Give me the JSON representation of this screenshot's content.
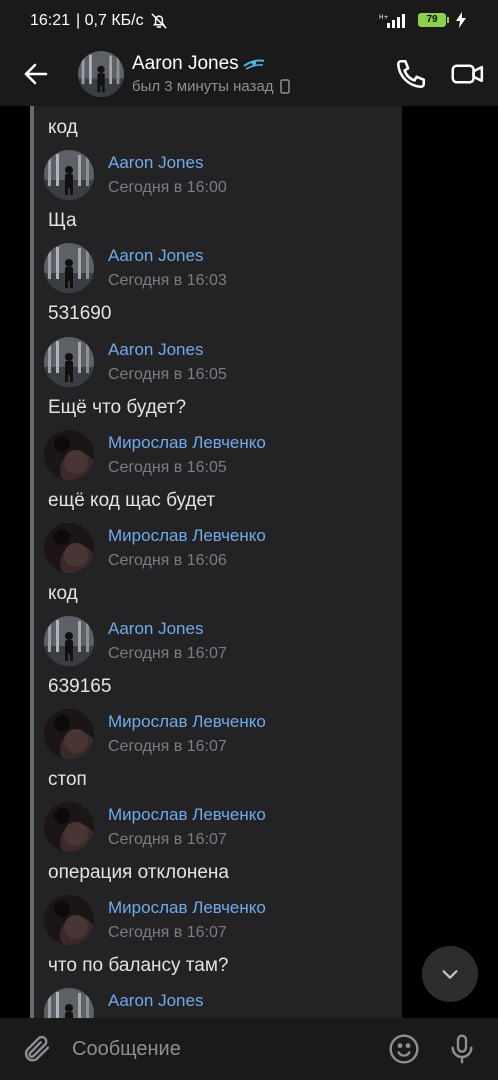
{
  "status_bar": {
    "time": "16:21",
    "network_speed": "| 0,7 КБ/с",
    "battery_level": "79",
    "icons": [
      "bell-off-icon",
      "signal-icon",
      "battery-icon",
      "charging-icon"
    ]
  },
  "header": {
    "title": "Aaron Jones",
    "status": "был 3 минуты назад",
    "badge_icon": "zenit-logo-icon",
    "device_icon": "phone-device-icon"
  },
  "messages": [
    {
      "author": "",
      "time": "",
      "text": "код"
    },
    {
      "author": "Aaron Jones",
      "time": "Сегодня в 16:00",
      "text": "Ща",
      "avatar": "aaron"
    },
    {
      "author": "Aaron Jones",
      "time": "Сегодня в 16:03",
      "text": "531690",
      "avatar": "aaron"
    },
    {
      "author": "Aaron Jones",
      "time": "Сегодня в 16:05",
      "text": "Ещё что будет?",
      "avatar": "aaron"
    },
    {
      "author": "Мирослав Левченко",
      "time": "Сегодня в 16:05",
      "text": "ещё код щас будет",
      "avatar": "miroslav"
    },
    {
      "author": "Мирослав Левченко",
      "time": "Сегодня в 16:06",
      "text": "код",
      "avatar": "miroslav"
    },
    {
      "author": "Aaron Jones",
      "time": "Сегодня в 16:07",
      "text": "639165",
      "avatar": "aaron"
    },
    {
      "author": "Мирослав Левченко",
      "time": "Сегодня в 16:07",
      "text": "стоп",
      "avatar": "miroslav"
    },
    {
      "author": "Мирослав Левченко",
      "time": "Сегодня в 16:07",
      "text": "операция отклонена",
      "avatar": "miroslav"
    },
    {
      "author": "Мирослав Левченко",
      "time": "Сегодня в 16:07",
      "text": "что по балансу там?",
      "avatar": "miroslav"
    },
    {
      "author": "Aaron Jones",
      "time": "",
      "text": "",
      "avatar": "aaron"
    }
  ],
  "composer": {
    "placeholder": "Сообщение"
  },
  "colors": {
    "accent": "#71aaeb",
    "background": "#000000",
    "panel": "#232325",
    "bar": "#1a1a1a"
  }
}
